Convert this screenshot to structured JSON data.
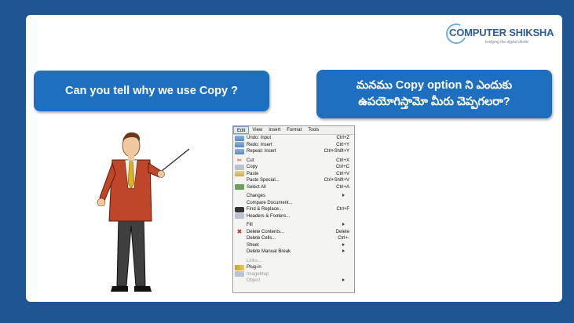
{
  "logo": {
    "brand": "COMPUTER SHIKSHA",
    "tagline": "bridging the digital divide"
  },
  "question_en": "Can you tell why we use Copy ?",
  "question_te_line1": "మనము Copy option ని ఎందుకు",
  "question_te_line2": "ఉపయోగిస్తామో మీరు చెప్పగలరా?",
  "colors": {
    "background": "#1f5592",
    "box": "#1f6fc1",
    "logo": "#2b5e96"
  },
  "menubar": [
    "Edit",
    "View",
    "Insert",
    "Format",
    "Tools"
  ],
  "menu_items": [
    {
      "label": "Undo: Input",
      "shortcut": "Ctrl+Z",
      "icon": "undo-icon"
    },
    {
      "label": "Redo: Insert",
      "shortcut": "Ctrl+Y",
      "icon": "redo-icon"
    },
    {
      "label": "Repeat: Insert",
      "shortcut": "Ctrl+Shift+Y",
      "icon": "repeat-icon"
    },
    {
      "sep": true
    },
    {
      "label": "Cut",
      "shortcut": "Ctrl+X",
      "icon": "scissors-icon"
    },
    {
      "label": "Copy",
      "shortcut": "Ctrl+C",
      "icon": "copy-icon"
    },
    {
      "label": "Paste",
      "shortcut": "Ctrl+V",
      "icon": "paste-icon"
    },
    {
      "label": "Paste Special...",
      "shortcut": "Ctrl+Shift+V",
      "icon": ""
    },
    {
      "label": "Select All",
      "shortcut": "Ctrl+A",
      "icon": "select-all-icon"
    },
    {
      "sep": true
    },
    {
      "label": "Changes",
      "shortcut": "",
      "icon": "",
      "submenu": true
    },
    {
      "label": "Compare Document...",
      "shortcut": "",
      "icon": ""
    },
    {
      "label": "Find & Replace...",
      "shortcut": "Ctrl+F",
      "icon": "binoculars-icon"
    },
    {
      "label": "Headers & Footers...",
      "shortcut": "",
      "icon": "headers-icon"
    },
    {
      "sep": true
    },
    {
      "label": "Fill",
      "shortcut": "",
      "icon": "",
      "submenu": true
    },
    {
      "label": "Delete Contents...",
      "shortcut": "Delete",
      "icon": "delete-x-icon"
    },
    {
      "label": "Delete Cells...",
      "shortcut": "Ctrl+-",
      "icon": ""
    },
    {
      "label": "Sheet",
      "shortcut": "",
      "icon": "",
      "submenu": true
    },
    {
      "label": "Delete Manual Break",
      "shortcut": "",
      "icon": "",
      "submenu": true
    },
    {
      "sep": true
    },
    {
      "label": "Links...",
      "shortcut": "",
      "icon": "",
      "disabled": true
    },
    {
      "label": "Plug-in",
      "shortcut": "",
      "icon": "plugin-icon"
    },
    {
      "label": "ImageMap",
      "shortcut": "",
      "icon": "imagemap-icon",
      "disabled": true
    },
    {
      "label": "Object",
      "shortcut": "",
      "icon": "",
      "disabled": true,
      "submenu": true
    }
  ]
}
